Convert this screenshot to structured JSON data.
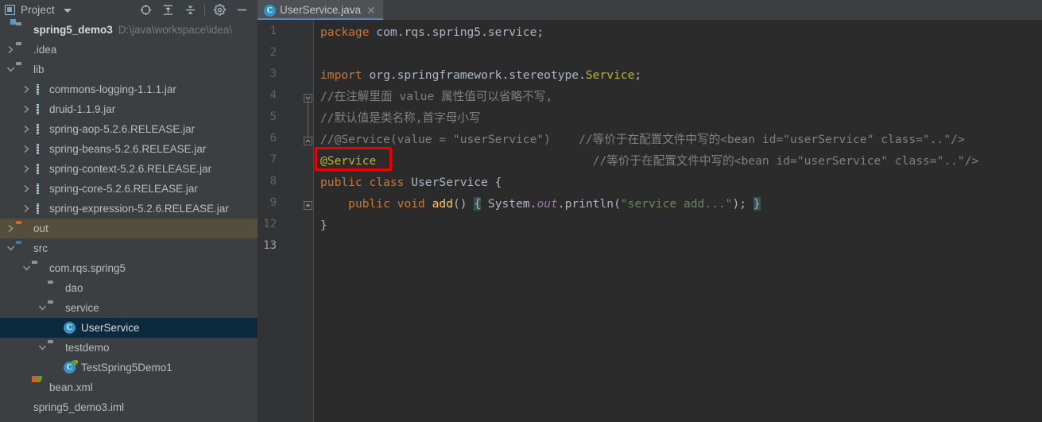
{
  "sidebar": {
    "tool_window": {
      "title": "Project",
      "icon": "project-icon",
      "dropdown_icon": "chevron-down-icon",
      "actions": [
        {
          "name": "select-opened-file-icon",
          "label": "Select Opened File"
        },
        {
          "name": "expand-all-icon",
          "label": "Expand All"
        },
        {
          "name": "collapse-all-icon",
          "label": "Collapse All"
        },
        {
          "name": "gear-icon",
          "label": "Settings"
        },
        {
          "name": "hide-icon",
          "label": "Hide"
        }
      ]
    },
    "tree": [
      {
        "label": "spring5_demo3",
        "sub": "D:\\java\\workspace\\idea\\",
        "icon": "project-root-icon",
        "indent": 0,
        "arrow": "none",
        "bold": true,
        "state": "none"
      },
      {
        "label": ".idea",
        "sub": "",
        "icon": "folder-icon",
        "indent": 0,
        "arrow": "collapsed",
        "bold": false,
        "state": "none"
      },
      {
        "label": "lib",
        "sub": "",
        "icon": "folder-icon",
        "indent": 0,
        "arrow": "expanded",
        "bold": false,
        "state": "none"
      },
      {
        "label": "commons-logging-1.1.1.jar",
        "sub": "",
        "icon": "jar-icon",
        "indent": 1,
        "arrow": "collapsed",
        "bold": false,
        "state": "none"
      },
      {
        "label": "druid-1.1.9.jar",
        "sub": "",
        "icon": "jar-icon",
        "indent": 1,
        "arrow": "collapsed",
        "bold": false,
        "state": "none"
      },
      {
        "label": "spring-aop-5.2.6.RELEASE.jar",
        "sub": "",
        "icon": "jar-icon",
        "indent": 1,
        "arrow": "collapsed",
        "bold": false,
        "state": "none"
      },
      {
        "label": "spring-beans-5.2.6.RELEASE.jar",
        "sub": "",
        "icon": "jar-icon",
        "indent": 1,
        "arrow": "collapsed",
        "bold": false,
        "state": "none"
      },
      {
        "label": "spring-context-5.2.6.RELEASE.jar",
        "sub": "",
        "icon": "jar-icon",
        "indent": 1,
        "arrow": "collapsed",
        "bold": false,
        "state": "none"
      },
      {
        "label": "spring-core-5.2.6.RELEASE.jar",
        "sub": "",
        "icon": "jar-icon",
        "indent": 1,
        "arrow": "collapsed",
        "bold": false,
        "state": "none"
      },
      {
        "label": "spring-expression-5.2.6.RELEASE.jar",
        "sub": "",
        "icon": "jar-icon",
        "indent": 1,
        "arrow": "collapsed",
        "bold": false,
        "state": "none"
      },
      {
        "label": "out",
        "sub": "",
        "icon": "folder-orange-icon",
        "indent": 0,
        "arrow": "collapsed",
        "bold": false,
        "state": "hover"
      },
      {
        "label": "src",
        "sub": "",
        "icon": "folder-blue-icon",
        "indent": 0,
        "arrow": "expanded",
        "bold": false,
        "state": "none"
      },
      {
        "label": "com.rqs.spring5",
        "sub": "",
        "icon": "package-icon",
        "indent": 1,
        "arrow": "expanded",
        "bold": false,
        "state": "none"
      },
      {
        "label": "dao",
        "sub": "",
        "icon": "package-icon",
        "indent": 2,
        "arrow": "none",
        "bold": false,
        "state": "none"
      },
      {
        "label": "service",
        "sub": "",
        "icon": "package-icon",
        "indent": 2,
        "arrow": "expanded",
        "bold": false,
        "state": "none"
      },
      {
        "label": "UserService",
        "sub": "",
        "icon": "java-class-icon",
        "indent": 3,
        "arrow": "none",
        "bold": false,
        "state": "selected"
      },
      {
        "label": "testdemo",
        "sub": "",
        "icon": "package-icon",
        "indent": 2,
        "arrow": "expanded",
        "bold": false,
        "state": "none"
      },
      {
        "label": "TestSpring5Demo1",
        "sub": "",
        "icon": "java-test-class-icon",
        "indent": 3,
        "arrow": "none",
        "bold": false,
        "state": "none"
      },
      {
        "label": "bean.xml",
        "sub": "",
        "icon": "xml-file-icon",
        "indent": 1,
        "arrow": "none",
        "bold": false,
        "state": "none"
      },
      {
        "label": "spring5_demo3.iml",
        "sub": "",
        "icon": "iml-file-icon",
        "indent": 0,
        "arrow": "none",
        "bold": false,
        "state": "none"
      }
    ]
  },
  "editor": {
    "tab": {
      "label": "UserService.java",
      "icon": "java-class-icon",
      "close_icon": "close-icon",
      "active": true
    },
    "line_numbers": [
      "1",
      "2",
      "3",
      "4",
      "5",
      "6",
      "7",
      "8",
      "9",
      "12",
      "13"
    ],
    "current_line_number": "13",
    "folds": [
      {
        "line_index": 3,
        "type": "fold-start"
      },
      {
        "line_index": 5,
        "type": "fold-end"
      },
      {
        "line_index": 8,
        "type": "fold-collapsed"
      }
    ],
    "annotation": {
      "name": "red-highlight-box",
      "color": "#ef0000",
      "target_text": "@Service"
    },
    "code_lines": [
      [
        {
          "t": "package",
          "c": "kw"
        },
        {
          "t": " com.rqs.spring5.service;",
          "c": "plain"
        }
      ],
      [],
      [
        {
          "t": "import",
          "c": "kw"
        },
        {
          "t": " org.springframework.stereotype.",
          "c": "plain"
        },
        {
          "t": "Service",
          "c": "an"
        },
        {
          "t": ";",
          "c": "plain"
        }
      ],
      [
        {
          "t": "//在注解里面 value 属性值可以省略不写,",
          "c": "cm"
        }
      ],
      [
        {
          "t": "//默认值是类名称,首字母小写",
          "c": "cm"
        }
      ],
      [
        {
          "t": "//@Service(value = \"userService\")    //等价于在配置文件中写的<bean id=\"userService\" class=\"..\"/>",
          "c": "cm"
        }
      ],
      [
        {
          "t": "@Service",
          "c": "an"
        },
        {
          "t": "                               //等价于在配置文件中写的<bean id=\"userService\" class=\"..\"/>",
          "c": "cm"
        }
      ],
      [
        {
          "t": "public",
          "c": "kw"
        },
        {
          "t": " ",
          "c": "plain"
        },
        {
          "t": "class",
          "c": "kw"
        },
        {
          "t": " UserService {",
          "c": "plain"
        }
      ],
      [
        {
          "t": "    ",
          "c": "plain"
        },
        {
          "t": "public",
          "c": "kw"
        },
        {
          "t": " ",
          "c": "plain"
        },
        {
          "t": "void",
          "c": "kw"
        },
        {
          "t": " ",
          "c": "plain"
        },
        {
          "t": "add",
          "c": "mth"
        },
        {
          "t": "() ",
          "c": "plain"
        },
        {
          "t": "{",
          "c": "brace-hl"
        },
        {
          "t": " System.",
          "c": "plain"
        },
        {
          "t": "out",
          "c": "fld"
        },
        {
          "t": ".println(",
          "c": "plain"
        },
        {
          "t": "\"service add...\"",
          "c": "st"
        },
        {
          "t": "); ",
          "c": "plain"
        },
        {
          "t": "}",
          "c": "brace-hl"
        }
      ],
      [
        {
          "t": "}",
          "c": "plain"
        }
      ],
      []
    ]
  },
  "colors": {
    "sidebar_bg": "#3c3f41",
    "editor_bg": "#2b2b2b",
    "gutter_bg": "#313335",
    "tab_active_bg": "#4e5254",
    "tab_underline": "#4a88c7",
    "selection_bg": "#0d293e",
    "hover_bg": "#544f3d",
    "annotation_red": "#ef0000"
  }
}
